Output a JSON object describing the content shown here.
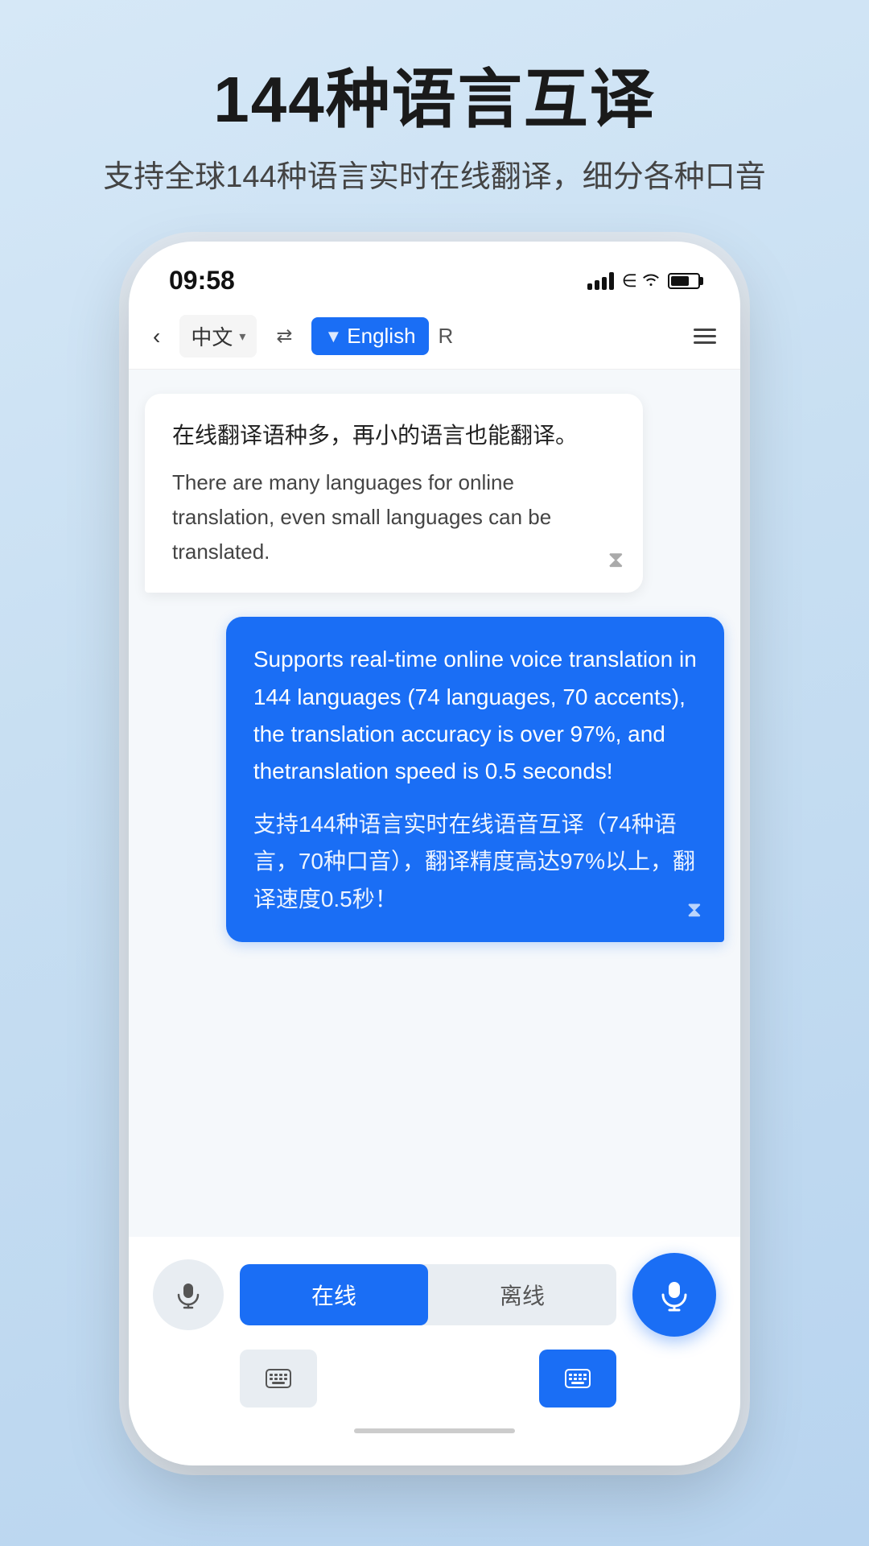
{
  "header": {
    "title": "144种语言互译",
    "subtitle": "支持全球144种语言实时在线翻译，细分各种口音"
  },
  "statusBar": {
    "time": "09:58",
    "signal": "signal",
    "wifi": "wifi",
    "battery": "battery"
  },
  "navBar": {
    "back": "‹",
    "leftLang": "中文",
    "swapIcon": "⇄",
    "rightLang": "English",
    "langTag": "▼",
    "rLabel": "R",
    "menuLabel": "menu"
  },
  "bubbleLeft": {
    "cnText": "在线翻译语种多，再小的语言也能翻译。",
    "enText": "There are many languages for online translation, even small languages can be translated."
  },
  "bubbleRight": {
    "enText": "Supports real-time online voice translation in 144 languages (74 languages, 70 accents), the translation accuracy is over 97%, and thetranslation speed is 0.5 seconds!",
    "cnText": "支持144种语言实时在线语音互译（74种语言，70种口音），翻译精度高达97%以上，翻译速度0.5秒！"
  },
  "bottomControls": {
    "onlineLabel": "在线",
    "offlineLabel": "离线",
    "micIcon": "🎤",
    "keyboardIcon": "⌨"
  }
}
